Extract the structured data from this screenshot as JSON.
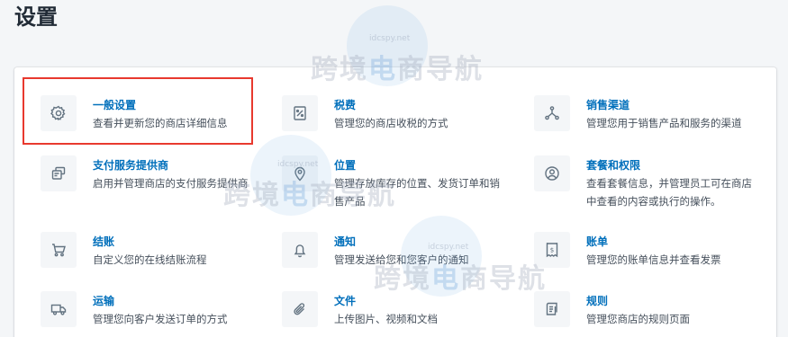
{
  "page": {
    "title": "设置"
  },
  "items": [
    {
      "title": "一般设置",
      "desc": "查看并更新您的商店详细信息",
      "icon": "gear-icon"
    },
    {
      "title": "税费",
      "desc": "管理您的商店收税的方式",
      "icon": "percent-icon"
    },
    {
      "title": "销售渠道",
      "desc": "管理您用于销售产品和服务的渠道",
      "icon": "channels-icon"
    },
    {
      "title": "支付服务提供商",
      "desc": "启用并管理商店的支付服务提供商",
      "icon": "payment-icon"
    },
    {
      "title": "位置",
      "desc": "管理存放库存的位置、发货订单和销售产品",
      "icon": "location-icon"
    },
    {
      "title": "套餐和权限",
      "desc": "查看套餐信息，并管理员工可在商店中查看的内容或执行的操作。",
      "icon": "user-icon"
    },
    {
      "title": "结账",
      "desc": "自定义您的在线结账流程",
      "icon": "cart-icon"
    },
    {
      "title": "通知",
      "desc": "管理发送给您和您客户的通知",
      "icon": "bell-icon"
    },
    {
      "title": "账单",
      "desc": "管理您的账单信息并查看发票",
      "icon": "invoice-icon"
    },
    {
      "title": "运输",
      "desc": "管理您向客户发送订单的方式",
      "icon": "truck-icon"
    },
    {
      "title": "文件",
      "desc": "上传图片、视频和文档",
      "icon": "paperclip-icon"
    },
    {
      "title": "规则",
      "desc": "管理您商店的规则页面",
      "icon": "rules-icon"
    }
  ],
  "watermark": {
    "text_a": "跨境",
    "text_e": "电",
    "text_b": "商导航",
    "sub": "idcspy.net"
  },
  "colors": {
    "link": "#006fbb",
    "highlight": "#e8392e",
    "icon_bg": "#f4f6f8"
  }
}
